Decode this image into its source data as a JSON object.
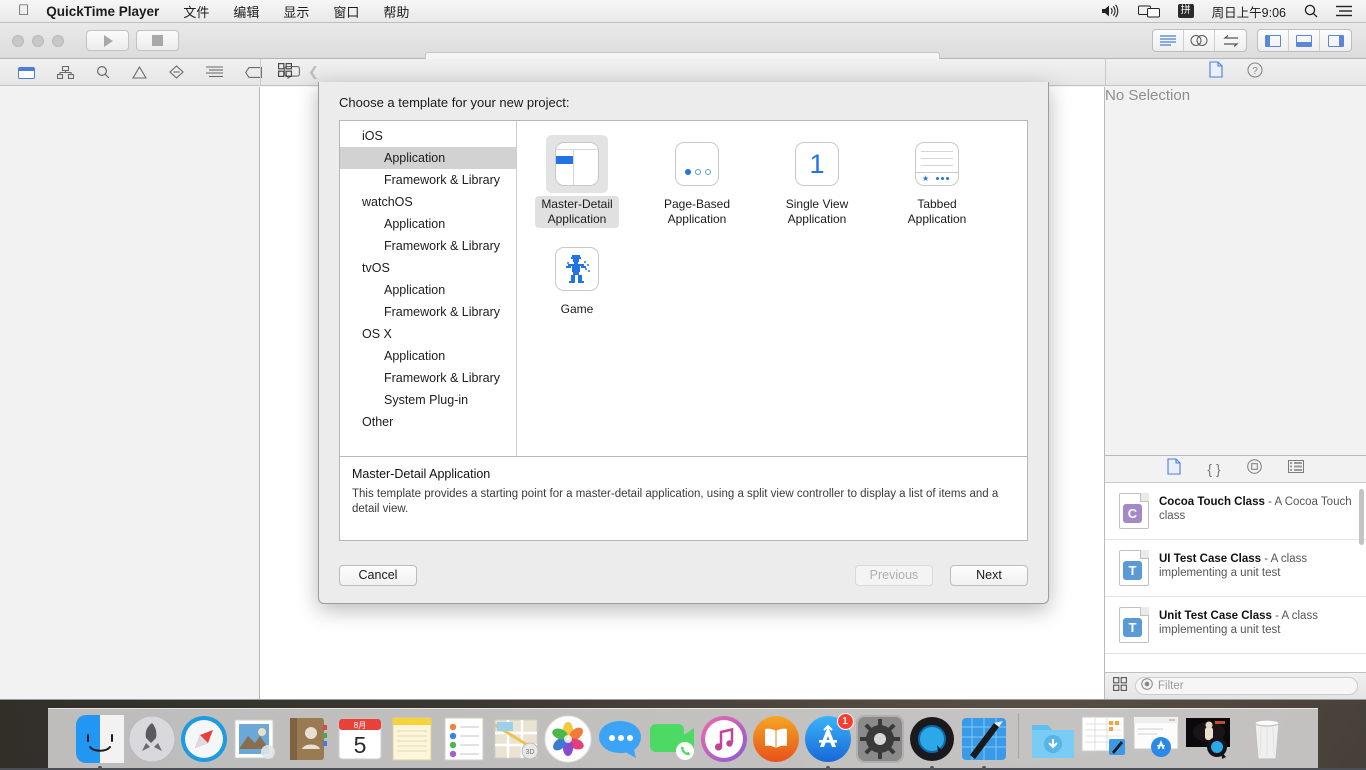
{
  "menubar": {
    "apple_icon": "apple-logo",
    "app_name": "QuickTime Player",
    "items": [
      "文件",
      "编辑",
      "显示",
      "窗口",
      "帮助"
    ],
    "status": {
      "volume_icon": "speaker-icon",
      "airplay_icon": "screen-mirroring-icon",
      "input_method": "拼",
      "clock": "周日上午9:06",
      "search_icon": "spotlight-search-icon",
      "notification_icon": "notification-center-icon"
    }
  },
  "xcode": {
    "toolbar": {
      "run_icon": "run-play-icon",
      "stop_icon": "stop-square-icon",
      "scheme_field_value": "",
      "editor_segments": [
        "standard-editor-icon",
        "assistant-editor-icon",
        "version-editor-icon"
      ],
      "panel_segments": [
        "navigator-toggle-icon",
        "debug-area-toggle-icon",
        "utilities-toggle-icon"
      ]
    },
    "navbar_icons": [
      "folder-icon",
      "hierarchy-icon",
      "search-icon",
      "warning-icon",
      "breakpoint-icon",
      "report-icon",
      "tag-icon",
      "message-icon"
    ],
    "jump_icons": [
      "grid-icon",
      "chevron-left-icon"
    ],
    "utility_icons": [
      "file-inspector-icon",
      "help-inspector-icon"
    ],
    "editor": {
      "placeholder": "No Selection"
    },
    "utilities": {
      "library_tabs": [
        "file-template-library-icon",
        "code-snippet-library-icon",
        "object-library-icon",
        "media-library-icon"
      ],
      "library_items": [
        {
          "title": "Cocoa Touch Class",
          "desc": "- A Cocoa Touch class",
          "icon_letter": "C",
          "icon_color": "#a489c9"
        },
        {
          "title": "UI Test Case Class",
          "desc": "- A class implementing a unit test",
          "icon_letter": "T",
          "icon_color": "#5b9bd5"
        },
        {
          "title": "Unit Test Case Class",
          "desc": "- A class implementing a unit test",
          "icon_letter": "T",
          "icon_color": "#5b9bd5"
        }
      ],
      "filter": {
        "placeholder": "Filter",
        "view_icon": "grid-view-icon",
        "search_icon": "filter-circle-icon"
      }
    }
  },
  "sheet": {
    "title": "Choose a template for your new project:",
    "sidebar": [
      {
        "label": "iOS",
        "type": "group",
        "selected": false
      },
      {
        "label": "Application",
        "type": "item",
        "selected": true
      },
      {
        "label": "Framework & Library",
        "type": "item",
        "selected": false
      },
      {
        "label": "watchOS",
        "type": "group",
        "selected": false
      },
      {
        "label": "Application",
        "type": "item",
        "selected": false
      },
      {
        "label": "Framework & Library",
        "type": "item",
        "selected": false
      },
      {
        "label": "tvOS",
        "type": "group",
        "selected": false
      },
      {
        "label": "Application",
        "type": "item",
        "selected": false
      },
      {
        "label": "Framework & Library",
        "type": "item",
        "selected": false
      },
      {
        "label": "OS X",
        "type": "group",
        "selected": false
      },
      {
        "label": "Application",
        "type": "item",
        "selected": false
      },
      {
        "label": "Framework & Library",
        "type": "item",
        "selected": false
      },
      {
        "label": "System Plug-in",
        "type": "item",
        "selected": false
      },
      {
        "label": "Other",
        "type": "group",
        "selected": false
      }
    ],
    "templates": [
      {
        "line1": "Master-Detail",
        "line2": "Application",
        "icon": "master-detail-icon",
        "selected": true
      },
      {
        "line1": "Page-Based",
        "line2": "Application",
        "icon": "page-based-icon",
        "selected": false
      },
      {
        "line1": "Single View",
        "line2": "Application",
        "icon": "single-view-icon",
        "selected": false
      },
      {
        "line1": "Tabbed",
        "line2": "Application",
        "icon": "tabbed-icon",
        "selected": false
      },
      {
        "line1": "Game",
        "line2": "",
        "icon": "game-icon",
        "selected": false
      }
    ],
    "description": {
      "title": "Master-Detail Application",
      "body": "This template provides a starting point for a master-detail application, using a split view controller to display a list of items and a detail view."
    },
    "buttons": {
      "cancel": "Cancel",
      "previous": "Previous",
      "next": "Next"
    },
    "accent_color": "#1a73e8"
  },
  "dock": {
    "apps": [
      {
        "name": "finder",
        "running": true
      },
      {
        "name": "launchpad",
        "running": false
      },
      {
        "name": "safari",
        "running": false
      },
      {
        "name": "mail",
        "running": false
      },
      {
        "name": "contacts",
        "running": false
      },
      {
        "name": "calendar",
        "running": false,
        "month": "8月",
        "day": "5"
      },
      {
        "name": "notes",
        "running": false
      },
      {
        "name": "reminders",
        "running": false
      },
      {
        "name": "maps",
        "running": false
      },
      {
        "name": "photos",
        "running": false
      },
      {
        "name": "messages",
        "running": false
      },
      {
        "name": "facetime",
        "running": false
      },
      {
        "name": "itunes",
        "running": false
      },
      {
        "name": "ibooks",
        "running": false
      },
      {
        "name": "app-store",
        "running": true,
        "badge": "1"
      },
      {
        "name": "system-preferences",
        "running": false
      },
      {
        "name": "quicktime-player",
        "running": true
      },
      {
        "name": "xcode",
        "running": true
      }
    ],
    "minimized": [
      "downloads-folder",
      "xcode-window",
      "app-store-window",
      "quicktime-window"
    ],
    "trash": "trash-icon"
  }
}
